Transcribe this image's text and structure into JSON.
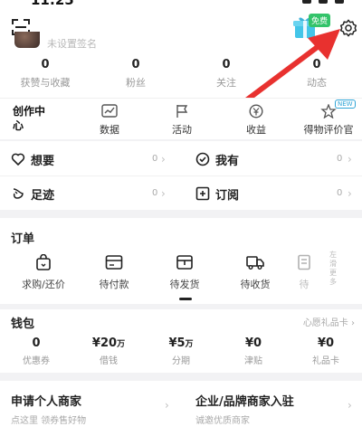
{
  "status_bar": {
    "time": "11:25"
  },
  "header": {
    "nickname": "未设置签名",
    "gift_badge": "免费"
  },
  "stats": [
    {
      "value": "0",
      "label": "获赞与收藏"
    },
    {
      "value": "0",
      "label": "粉丝"
    },
    {
      "value": "0",
      "label": "关注"
    },
    {
      "value": "0",
      "label": "动态"
    }
  ],
  "creator": {
    "title": "创作中心",
    "items": [
      {
        "label": "数据",
        "icon": "chart-icon"
      },
      {
        "label": "活动",
        "icon": "flag-icon"
      },
      {
        "label": "收益",
        "icon": "yen-icon"
      },
      {
        "label": "得物评价官",
        "icon": "star-icon"
      }
    ],
    "new_badge": "NEW"
  },
  "quick": [
    {
      "label": "想要",
      "count": "0",
      "icon": "heart-icon"
    },
    {
      "label": "我有",
      "count": "0",
      "icon": "check-circle-icon"
    },
    {
      "label": "足迹",
      "count": "0",
      "icon": "footprint-icon"
    },
    {
      "label": "订阅",
      "count": "0",
      "icon": "plus-square-icon"
    }
  ],
  "orders": {
    "title": "订单",
    "items": [
      {
        "label": "求购/还价",
        "icon": "bag-icon"
      },
      {
        "label": "待付款",
        "icon": "card-icon"
      },
      {
        "label": "待发货",
        "icon": "box-icon"
      },
      {
        "label": "待收货",
        "icon": "truck-icon"
      },
      {
        "label": "待",
        "icon": "receipt-icon"
      }
    ],
    "more": "左滑更多"
  },
  "wallet": {
    "title": "钱包",
    "link": "心愿礼品卡",
    "items": [
      {
        "value": "0",
        "unit": "",
        "label": "优惠券"
      },
      {
        "value": "¥20",
        "unit": "万",
        "label": "借钱"
      },
      {
        "value": "¥5",
        "unit": "万",
        "label": "分期"
      },
      {
        "value": "¥0",
        "unit": "",
        "label": "津贴"
      },
      {
        "value": "¥0",
        "unit": "",
        "label": "礼品卡"
      }
    ]
  },
  "merchant": [
    {
      "title": "申请个人商家",
      "sub": "点这里 领券售好物"
    },
    {
      "title": "企业/品牌商家入驻",
      "sub": "诚邀优质商家"
    }
  ],
  "colors": {
    "accent": "#2fa4d6",
    "arrow": "#e8312f",
    "badge": "#33c36a"
  }
}
